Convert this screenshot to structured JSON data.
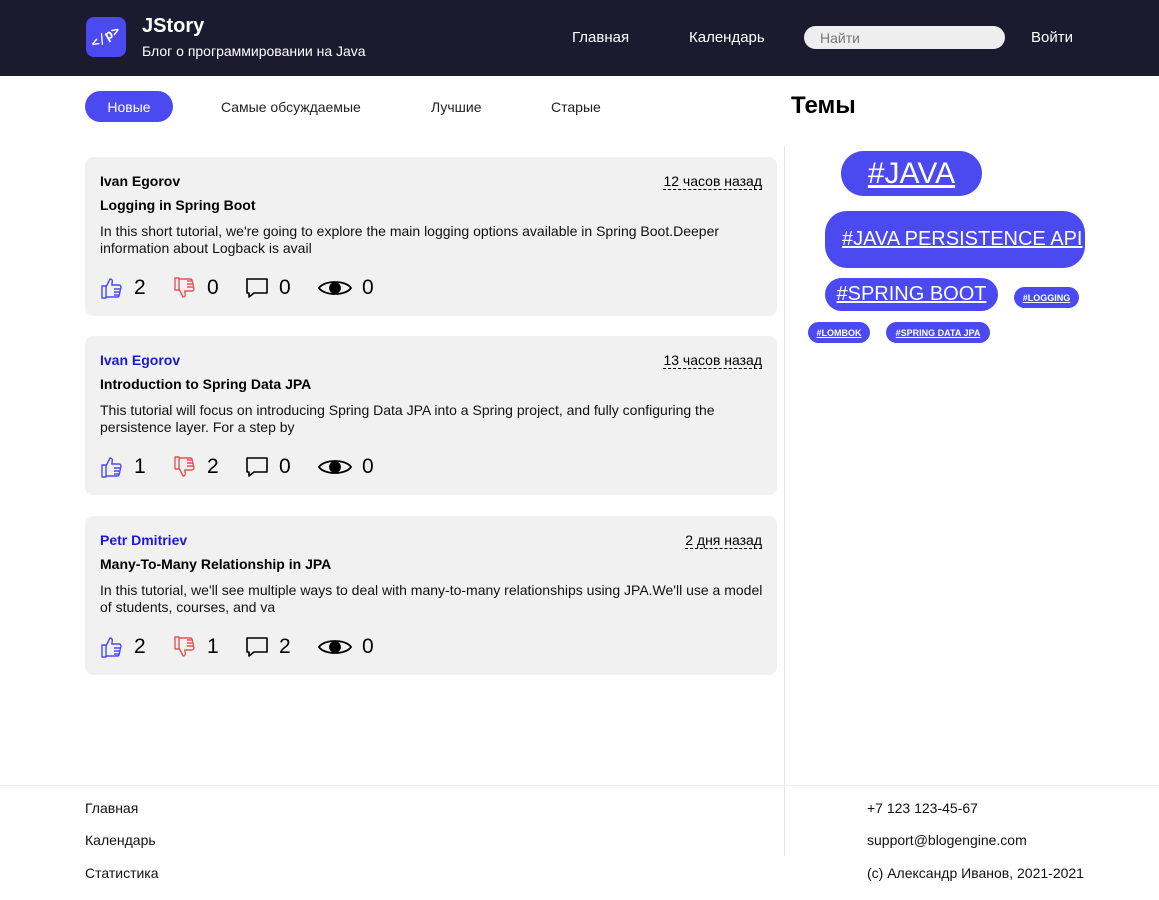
{
  "header": {
    "logo_text": "</p>",
    "brand_title": "JStory",
    "brand_subtitle": "Блог о программировании на Java",
    "nav": {
      "home": "Главная",
      "calendar": "Календарь"
    },
    "search_placeholder": "Найти",
    "login": "Войти",
    "background": "#1c1a2e",
    "accent": "#4a4af0"
  },
  "tabs": [
    "Новые",
    "Самые обсуждаемые",
    "Лучшие",
    "Старые"
  ],
  "active_tab": "Новые",
  "topics": {
    "title": "Темы",
    "tags": [
      "#JAVA",
      "#JAVA PERSISTENCE API",
      "#SPRING BOOT",
      "#LOGGING",
      "#LOMBOK",
      "#SPRING DATA JPA"
    ]
  },
  "posts": [
    {
      "author": "Ivan Egorov",
      "time": "12 часов назад",
      "title": "Logging in Spring Boot",
      "excerpt": "In this short tutorial, we're going to explore the main logging options available in Spring Boot.Deeper information about Logback is avail",
      "likes": "2",
      "dislikes": "0",
      "comments": "0",
      "views": "0"
    },
    {
      "author": "Ivan Egorov",
      "time": "13 часов назад",
      "title": "Introduction to Spring Data JPA",
      "excerpt": "This tutorial will focus on introducing Spring Data JPA into a Spring project, and fully configuring the persistence layer. For a step by",
      "likes": "1",
      "dislikes": "2",
      "comments": "0",
      "views": "0"
    },
    {
      "author": "Petr Dmitriev",
      "time": "2 дня назад",
      "title": "Many-To-Many Relationship in JPA",
      "excerpt": "In this tutorial, we'll see multiple ways to deal with many-to-many relationships using JPA.We'll use a model of students, courses, and va",
      "likes": "2",
      "dislikes": "1",
      "comments": "2",
      "views": "0"
    }
  ],
  "footer": {
    "links": [
      "Главная",
      "Календарь",
      "Статистика"
    ],
    "phone": "+7 123 123-45-67",
    "email": "support@blogengine.com",
    "copyright": "(c) Александр Иванов, 2021-2021"
  }
}
